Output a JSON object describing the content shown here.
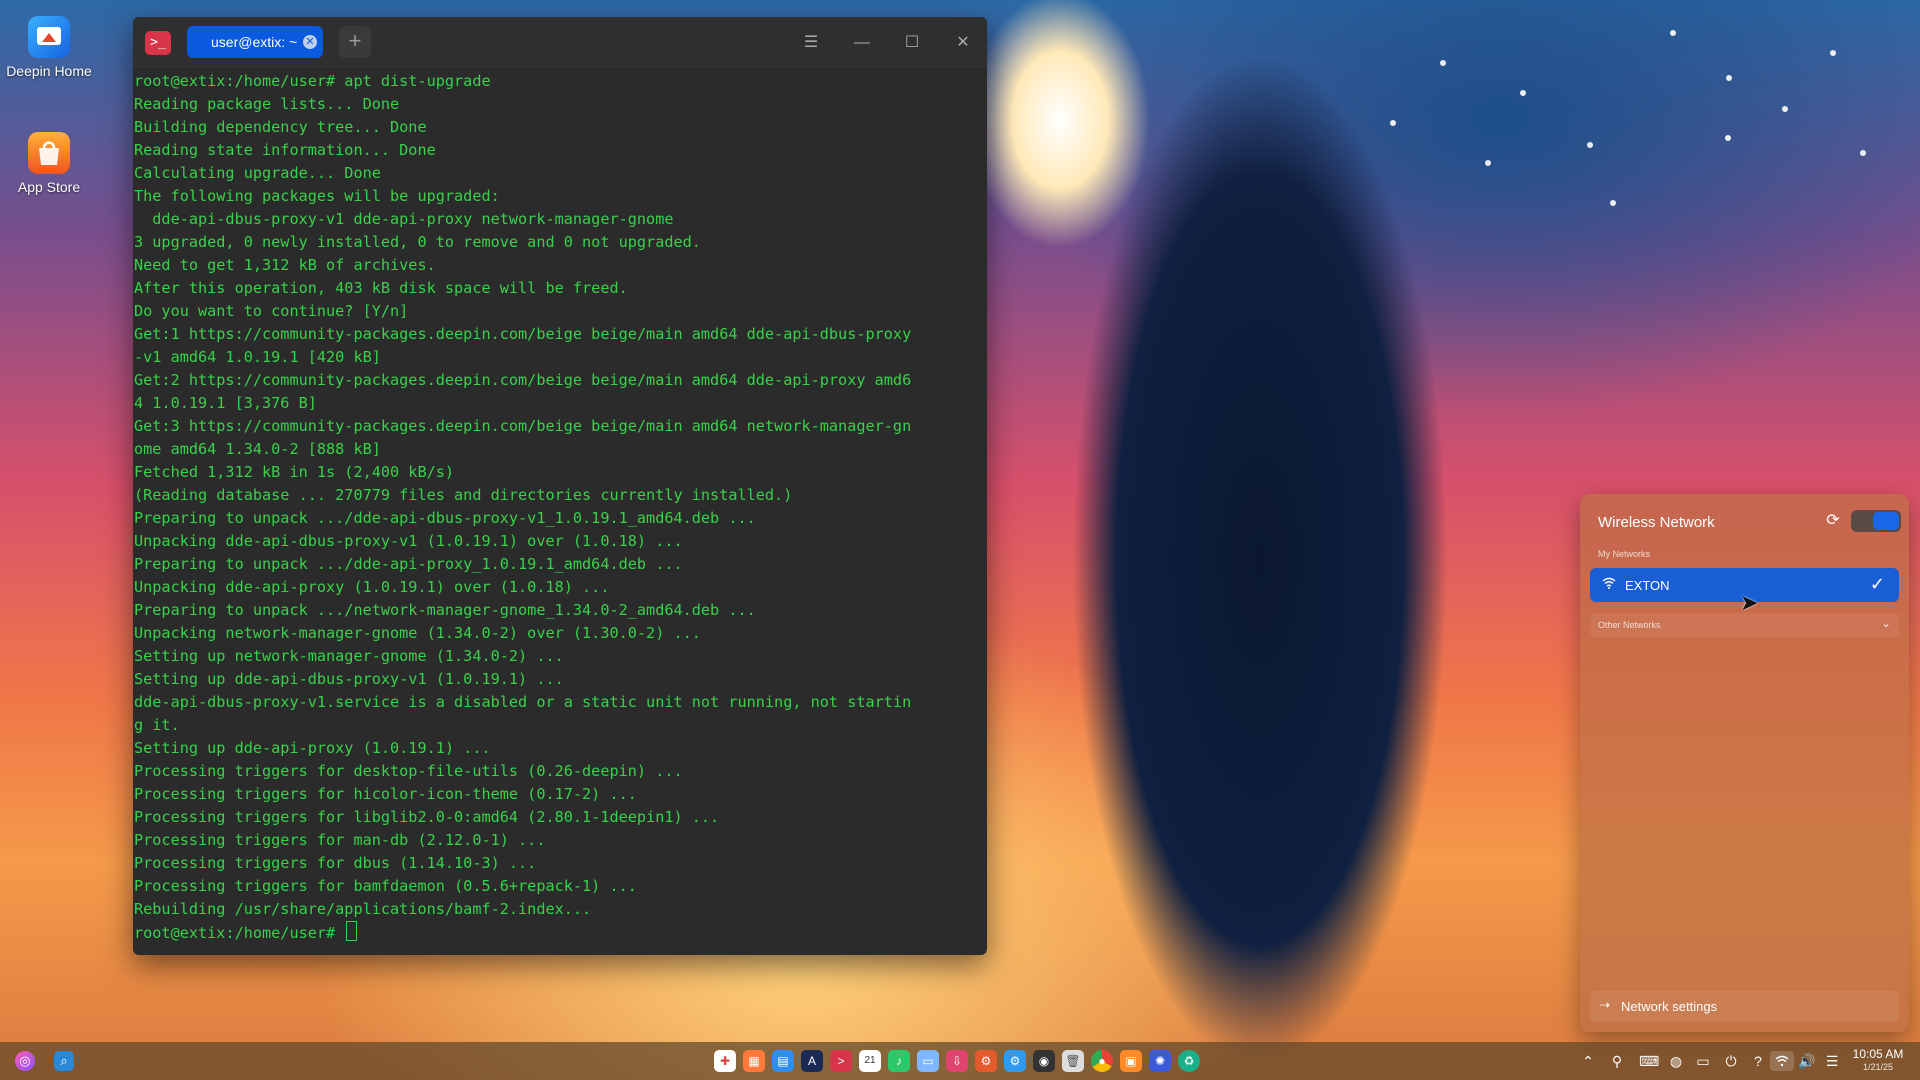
{
  "desktop": {
    "icons": [
      {
        "label": "Deepin Home",
        "icon": "deepin-home-icon"
      },
      {
        "label": "App Store",
        "icon": "app-store-icon"
      }
    ]
  },
  "terminal": {
    "tab_label": "user@extix: ~",
    "lines": [
      "root@extix:/home/user# apt dist-upgrade",
      "Reading package lists... Done",
      "Building dependency tree... Done",
      "Reading state information... Done",
      "Calculating upgrade... Done",
      "The following packages will be upgraded:",
      "  dde-api-dbus-proxy-v1 dde-api-proxy network-manager-gnome",
      "3 upgraded, 0 newly installed, 0 to remove and 0 not upgraded.",
      "Need to get 1,312 kB of archives.",
      "After this operation, 403 kB disk space will be freed.",
      "Do you want to continue? [Y/n]",
      "Get:1 https://community-packages.deepin.com/beige beige/main amd64 dde-api-dbus-proxy",
      "-v1 amd64 1.0.19.1 [420 kB]",
      "Get:2 https://community-packages.deepin.com/beige beige/main amd64 dde-api-proxy amd6",
      "4 1.0.19.1 [3,376 B]",
      "Get:3 https://community-packages.deepin.com/beige beige/main amd64 network-manager-gn",
      "ome amd64 1.34.0-2 [888 kB]",
      "Fetched 1,312 kB in 1s (2,400 kB/s)",
      "(Reading database ... 270779 files and directories currently installed.)",
      "Preparing to unpack .../dde-api-dbus-proxy-v1_1.0.19.1_amd64.deb ...",
      "Unpacking dde-api-dbus-proxy-v1 (1.0.19.1) over (1.0.18) ...",
      "Preparing to unpack .../dde-api-proxy_1.0.19.1_amd64.deb ...",
      "Unpacking dde-api-proxy (1.0.19.1) over (1.0.18) ...",
      "Preparing to unpack .../network-manager-gnome_1.34.0-2_amd64.deb ...",
      "Unpacking network-manager-gnome (1.34.0-2) over (1.30.0-2) ...",
      "Setting up network-manager-gnome (1.34.0-2) ...",
      "Setting up dde-api-dbus-proxy-v1 (1.0.19.1) ...",
      "dde-api-dbus-proxy-v1.service is a disabled or a static unit not running, not startin",
      "g it.",
      "Setting up dde-api-proxy (1.0.19.1) ...",
      "Processing triggers for desktop-file-utils (0.26-deepin) ...",
      "Processing triggers for hicolor-icon-theme (0.17-2) ...",
      "Processing triggers for libglib2.0-0:amd64 (2.80.1-1deepin1) ...",
      "Processing triggers for man-db (2.12.0-1) ...",
      "Processing triggers for dbus (1.14.10-3) ...",
      "Processing triggers for bamfdaemon (0.5.6+repack-1) ...",
      "Rebuilding /usr/share/applications/bamf-2.index...",
      "root@extix:/home/user# "
    ]
  },
  "wifi_panel": {
    "title": "Wireless Network",
    "enabled": true,
    "my_networks_label": "My Networks",
    "connected_network": "EXTON",
    "other_networks_label": "Other Networks",
    "settings_label": "Network settings"
  },
  "taskbar": {
    "time": "10:05 AM",
    "date": "1/21/25"
  },
  "colors": {
    "accent": "#1a5ed6",
    "terminal_text": "#38d24a",
    "terminal_bg": "#2b2b2b"
  }
}
